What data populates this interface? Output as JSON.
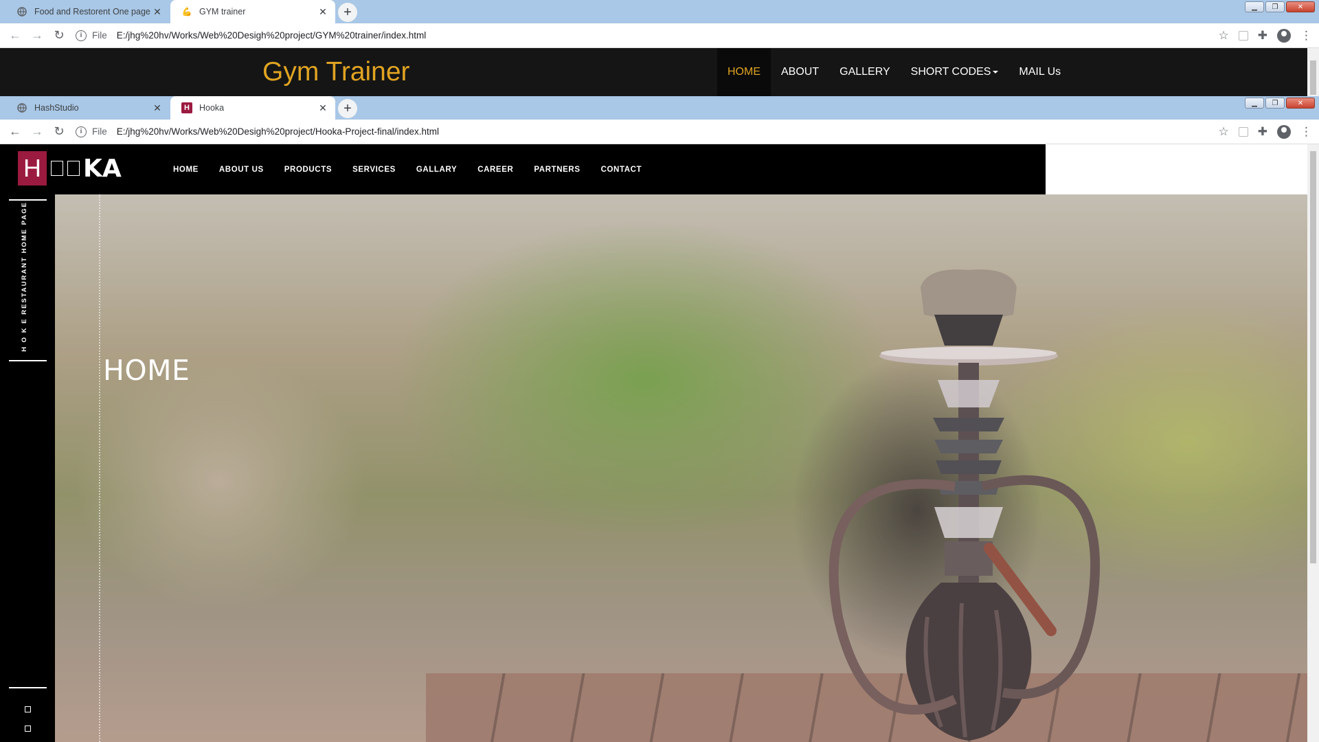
{
  "browser_back": {
    "tabs": [
      {
        "title": "Food and Restorent One page Te",
        "active": false
      },
      {
        "title": "GYM trainer",
        "active": true
      }
    ],
    "address": {
      "scheme_label": "File",
      "url": "E:/jhg%20hv/Works/Web%20Desigh%20project/GYM%20trainer/index.html"
    }
  },
  "gym_page": {
    "brand": "Gym Trainer",
    "nav": [
      {
        "label": "HOME",
        "active": true
      },
      {
        "label": "ABOUT"
      },
      {
        "label": "GALLERY"
      },
      {
        "label": "SHORT CODES"
      },
      {
        "label": "MAIL Us"
      }
    ]
  },
  "browser_front": {
    "tabs": [
      {
        "title": "HashStudio",
        "active": false
      },
      {
        "title": "Hooka",
        "active": true
      }
    ],
    "address": {
      "scheme_label": "File",
      "url": "E:/jhg%20hv/Works/Web%20Desigh%20project/Hooka-Project-final/index.html"
    }
  },
  "hooka_page": {
    "logo": {
      "mark": "H",
      "suffix": "KA"
    },
    "menu": [
      "HOME",
      "ABOUT US",
      "PRODUCTS",
      "SERVICES",
      "GALLARY",
      "CAREER",
      "PARTNERS",
      "CONTACT"
    ],
    "sidebar_text": "H O K E  RESTAURANT HOME PAGE",
    "hero_title": "HOME"
  },
  "colors": {
    "gym_accent": "#e0a422",
    "hooka_brand": "#9b1a3f",
    "chrome_frame": "#a9c7e6"
  }
}
